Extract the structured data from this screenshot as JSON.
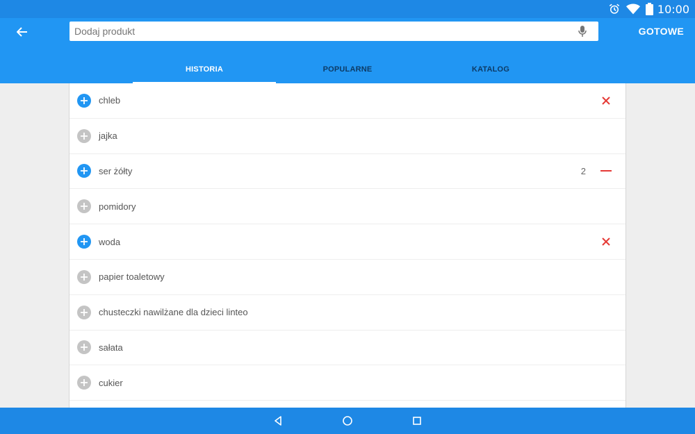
{
  "status_bar": {
    "time": "10:00"
  },
  "search": {
    "placeholder": "Dodaj produkt",
    "value": ""
  },
  "header": {
    "done_label": "GOTOWE"
  },
  "tabs": [
    {
      "label": "HISTORIA",
      "active": true
    },
    {
      "label": "POPULARNE",
      "active": false
    },
    {
      "label": "KATALOG",
      "active": false
    }
  ],
  "items": [
    {
      "name": "chleb",
      "added": true,
      "count": "",
      "action": "remove"
    },
    {
      "name": "jajka",
      "added": false,
      "count": "",
      "action": ""
    },
    {
      "name": "ser żółty",
      "added": true,
      "count": "2",
      "action": "decrement"
    },
    {
      "name": "pomidory",
      "added": false,
      "count": "",
      "action": ""
    },
    {
      "name": "woda",
      "added": true,
      "count": "",
      "action": "remove"
    },
    {
      "name": "papier toaletowy",
      "added": false,
      "count": "",
      "action": ""
    },
    {
      "name": "chusteczki nawilżane dla dzieci linteo",
      "added": false,
      "count": "",
      "action": ""
    },
    {
      "name": "sałata",
      "added": false,
      "count": "",
      "action": ""
    },
    {
      "name": "cukier",
      "added": false,
      "count": "",
      "action": ""
    }
  ],
  "colors": {
    "primary": "#2196f3",
    "status": "#1e88e5",
    "danger": "#e53935",
    "inactive": "#c4c4c4"
  },
  "icons": {
    "back": "arrow-left-icon",
    "mic": "microphone-icon",
    "add": "plus-icon",
    "remove": "close-icon",
    "decrement": "minus-icon",
    "nav": [
      "back-triangle-icon",
      "home-circle-icon",
      "recents-square-icon"
    ]
  }
}
